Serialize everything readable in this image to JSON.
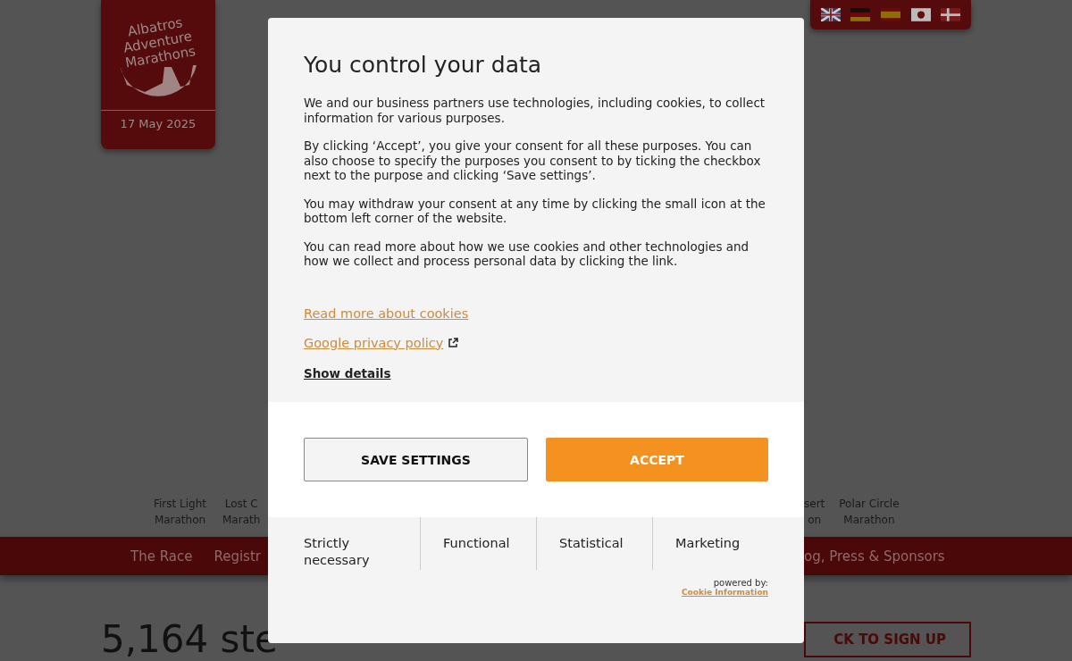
{
  "logo": {
    "lines": [
      "Albatros",
      "Adventure",
      "Marathons"
    ],
    "date": "17 May 2025"
  },
  "languages": [
    {
      "kind": "uk"
    },
    {
      "kind": "de"
    },
    {
      "kind": "es"
    },
    {
      "kind": "jp"
    },
    {
      "kind": "dk"
    }
  ],
  "races_left": [
    {
      "lines": [
        "First Light",
        "Marathon"
      ]
    },
    {
      "lines": [
        "Lost C",
        "Marath"
      ]
    }
  ],
  "races_right": [
    {
      "lines": [
        "sert",
        "on"
      ]
    },
    {
      "lines": [
        "Polar Circle",
        "Marathon"
      ]
    }
  ],
  "nav_left": [
    "The Race",
    "Registr"
  ],
  "nav_right": [
    "og, Press & Sponsors"
  ],
  "heading": "5,164 ste",
  "signup_button": "CK TO SIGN UP",
  "dialog": {
    "title": "You control your data",
    "paragraphs": [
      "We and our business partners use technologies, including cookies, to collect information for various purposes.",
      "By clicking ‘Accept’, you give your consent for all these purposes. You can also choose to specify the purposes you consent to by ticking the checkbox next to the purpose and clicking ‘Save settings’.",
      "You may withdraw your consent at any time by clicking the small icon at the bottom left corner of the website.",
      "You can read more about how we use cookies and other technologies and how we collect and process personal data by clicking the link."
    ],
    "links": [
      {
        "label": "Read more about cookies",
        "external": false
      },
      {
        "label": "Google privacy policy",
        "external": true
      }
    ],
    "show_details": "Show details",
    "buttons": [
      {
        "label": "SAVE SETTINGS",
        "kind": "secondary"
      },
      {
        "label": "ACCEPT",
        "kind": "primary"
      }
    ],
    "categories": [
      "Strictly necessary",
      "Functional",
      "Statistical",
      "Marketing"
    ],
    "powered_by": "powered by:",
    "provider": "Cookie Information"
  }
}
